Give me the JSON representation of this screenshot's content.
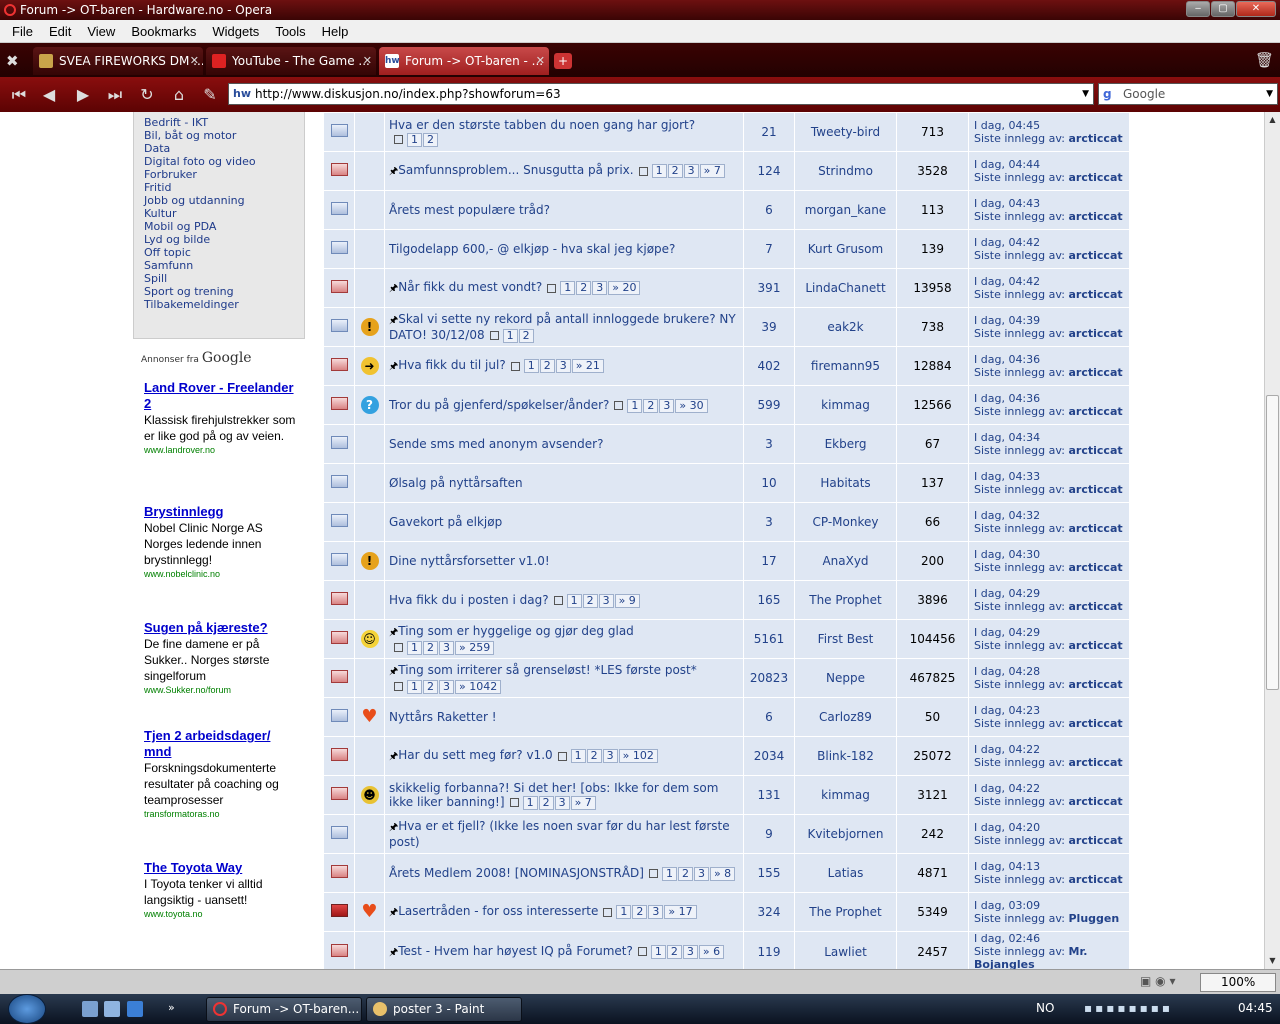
{
  "window": {
    "title": "Forum -> OT-baren - Hardware.no - Opera"
  },
  "menu": [
    "File",
    "Edit",
    "View",
    "Bookmarks",
    "Widgets",
    "Tools",
    "Help"
  ],
  "tabs": [
    {
      "label": "SVEA FIREWORKS DM ...",
      "active": false
    },
    {
      "label": "YouTube - The Game ...",
      "active": false
    },
    {
      "label": "Forum -> OT-baren - ...",
      "active": true
    }
  ],
  "address": {
    "url": "http://www.diskusjon.no/index.php?showforum=63",
    "search_placeholder": "Google"
  },
  "categories": [
    "Bedrift - IKT",
    "Bil, båt og motor",
    "Data",
    "Digital foto og video",
    "Forbruker",
    "Fritid",
    "Jobb og utdanning",
    "Kultur",
    "Mobil og PDA",
    "Lyd og bilde",
    "Off topic",
    "Samfunn",
    "Spill",
    "Sport og trening",
    "Tilbakemeldinger"
  ],
  "ads": {
    "header_prefix": "Annonser fra",
    "header_brand": "Google",
    "items": [
      {
        "title": "Land Rover - Freelander 2",
        "text": "Klassisk firehjulstrekker som er like god på og av veien.",
        "url": "www.landrover.no"
      },
      {
        "title": "Brystinnlegg",
        "text": "Nobel Clinic Norge AS Norges ledende innen brystinnlegg!",
        "url": "www.nobelclinic.no"
      },
      {
        "title": "Sugen på kjæreste?",
        "text": "De fine damene er på Sukker.. Norges største singelforum",
        "url": "www.Sukker.no/forum"
      },
      {
        "title": "Tjen 2 arbeidsdager/ mnd",
        "text": "Forskningsdokumenterte resultater på coaching og teamprosesser",
        "url": "transformatoras.no"
      },
      {
        "title": "The Toyota Way",
        "text": "I Toyota tenker vi alltid langsiktig - uansett!",
        "url": "www.toyota.no"
      }
    ]
  },
  "topics": [
    {
      "folder": "normal",
      "icon": "",
      "pinned": false,
      "title": "Hva er den største tabben du noen gang har gjort?",
      "pages": [
        "1",
        "2"
      ],
      "replies": "21",
      "author": "Tweety-bird",
      "views": "713",
      "time": "I dag, 04:45",
      "by_label": "Siste innlegg av:",
      "last_by": "arcticcat"
    },
    {
      "folder": "hot",
      "icon": "",
      "pinned": true,
      "title": "Samfunnsproblem... Snusgutta på prix.",
      "pages": [
        "1",
        "2",
        "3",
        "» 7"
      ],
      "replies": "124",
      "author": "Strindmo",
      "views": "3528",
      "time": "I dag, 04:44",
      "by_label": "Siste innlegg av:",
      "last_by": "arcticcat"
    },
    {
      "folder": "normal",
      "icon": "",
      "pinned": false,
      "title": "Årets mest populære tråd?",
      "pages": [],
      "replies": "6",
      "author": "morgan_kane",
      "views": "113",
      "time": "I dag, 04:43",
      "by_label": "Siste innlegg av:",
      "last_by": "arcticcat"
    },
    {
      "folder": "normal",
      "icon": "",
      "pinned": false,
      "title": "Tilgodelapp 600,- @ elkjøp - hva skal jeg kjøpe?",
      "pages": [],
      "replies": "7",
      "author": "Kurt Grusom",
      "views": "139",
      "time": "I dag, 04:42",
      "by_label": "Siste innlegg av:",
      "last_by": "arcticcat"
    },
    {
      "folder": "hot",
      "icon": "",
      "pinned": true,
      "title": "Når fikk du mest vondt?",
      "pages": [
        "1",
        "2",
        "3",
        "» 20"
      ],
      "replies": "391",
      "author": "LindaChanett",
      "views": "13958",
      "time": "I dag, 04:42",
      "by_label": "Siste innlegg av:",
      "last_by": "arcticcat"
    },
    {
      "folder": "normal",
      "icon": "warn",
      "pinned": true,
      "title": "Skal vi sette ny rekord på antall innloggede brukere? NY DATO! 30/12/08",
      "pages": [
        "1",
        "2"
      ],
      "replies": "39",
      "author": "eak2k",
      "views": "738",
      "time": "I dag, 04:39",
      "by_label": "Siste innlegg av:",
      "last_by": "arcticcat"
    },
    {
      "folder": "hot",
      "icon": "arrow",
      "pinned": true,
      "title": "Hva fikk du til jul?",
      "pages": [
        "1",
        "2",
        "3",
        "» 21"
      ],
      "replies": "402",
      "author": "firemann95",
      "views": "12884",
      "time": "I dag, 04:36",
      "by_label": "Siste innlegg av:",
      "last_by": "arcticcat"
    },
    {
      "folder": "hot",
      "icon": "question",
      "pinned": false,
      "title": "Tror du på gjenferd/spøkelser/ånder?",
      "pages": [
        "1",
        "2",
        "3",
        "» 30"
      ],
      "replies": "599",
      "author": "kimmag",
      "views": "12566",
      "time": "I dag, 04:36",
      "by_label": "Siste innlegg av:",
      "last_by": "arcticcat"
    },
    {
      "folder": "normal",
      "icon": "",
      "pinned": false,
      "title": "Sende sms med anonym avsender?",
      "pages": [],
      "replies": "3",
      "author": "Ekberg",
      "views": "67",
      "time": "I dag, 04:34",
      "by_label": "Siste innlegg av:",
      "last_by": "arcticcat"
    },
    {
      "folder": "normal",
      "icon": "",
      "pinned": false,
      "title": "Ølsalg på nyttårsaften",
      "pages": [],
      "replies": "10",
      "author": "Habitats",
      "views": "137",
      "time": "I dag, 04:33",
      "by_label": "Siste innlegg av:",
      "last_by": "arcticcat"
    },
    {
      "folder": "normal",
      "icon": "",
      "pinned": false,
      "title": "Gavekort på elkjøp",
      "pages": [],
      "replies": "3",
      "author": "CP-Monkey",
      "views": "66",
      "time": "I dag, 04:32",
      "by_label": "Siste innlegg av:",
      "last_by": "arcticcat"
    },
    {
      "folder": "normal",
      "icon": "warn",
      "pinned": false,
      "title": "Dine nyttårsforsetter v1.0!",
      "pages": [],
      "replies": "17",
      "author": "AnaXyd",
      "views": "200",
      "time": "I dag, 04:30",
      "by_label": "Siste innlegg av:",
      "last_by": "arcticcat"
    },
    {
      "folder": "hot",
      "icon": "",
      "pinned": false,
      "title": "Hva fikk du i posten i dag?",
      "pages": [
        "1",
        "2",
        "3",
        "» 9"
      ],
      "replies": "165",
      "author": "The Prophet",
      "views": "3896",
      "time": "I dag, 04:29",
      "by_label": "Siste innlegg av:",
      "last_by": "arcticcat"
    },
    {
      "folder": "hot",
      "icon": "smile",
      "pinned": true,
      "title": "Ting som er hyggelige og gjør deg glad",
      "pages": [
        "1",
        "2",
        "3",
        "» 259"
      ],
      "replies": "5161",
      "author": "First Best",
      "views": "104456",
      "time": "I dag, 04:29",
      "by_label": "Siste innlegg av:",
      "last_by": "arcticcat"
    },
    {
      "folder": "hot",
      "icon": "",
      "pinned": true,
      "title": "Ting som irriterer så grenseløst! *LES første post*",
      "pages": [
        "1",
        "2",
        "3",
        "» 1042"
      ],
      "replies": "20823",
      "author": "Neppe",
      "views": "467825",
      "time": "I dag, 04:28",
      "by_label": "Siste innlegg av:",
      "last_by": "arcticcat"
    },
    {
      "folder": "normal",
      "icon": "heart",
      "pinned": false,
      "title": "Nyttårs Raketter !",
      "pages": [],
      "replies": "6",
      "author": "Carloz89",
      "views": "50",
      "time": "I dag, 04:23",
      "by_label": "Siste innlegg av:",
      "last_by": "arcticcat"
    },
    {
      "folder": "hot",
      "icon": "",
      "pinned": true,
      "title": "Har du sett meg før? v1.0",
      "pages": [
        "1",
        "2",
        "3",
        "» 102"
      ],
      "replies": "2034",
      "author": "Blink-182",
      "views": "25072",
      "time": "I dag, 04:22",
      "by_label": "Siste innlegg av:",
      "last_by": "arcticcat"
    },
    {
      "folder": "hot",
      "icon": "cool",
      "pinned": false,
      "title": "skikkelig forbanna?! Si det her! [obs: Ikke for dem som ikke liker banning!]",
      "pages": [
        "1",
        "2",
        "3",
        "» 7"
      ],
      "replies": "131",
      "author": "kimmag",
      "views": "3121",
      "time": "I dag, 04:22",
      "by_label": "Siste innlegg av:",
      "last_by": "arcticcat"
    },
    {
      "folder": "normal",
      "icon": "",
      "pinned": true,
      "title": "Hva er et fjell? (Ikke les noen svar før du har lest første post)",
      "pages": [],
      "replies": "9",
      "author": "Kvitebjornen",
      "views": "242",
      "time": "I dag, 04:20",
      "by_label": "Siste innlegg av:",
      "last_by": "arcticcat"
    },
    {
      "folder": "hot",
      "icon": "",
      "pinned": false,
      "title": "Årets Medlem 2008! [NOMINASJONSTRÅD]",
      "pages": [
        "1",
        "2",
        "3",
        "» 8"
      ],
      "replies": "155",
      "author": "Latias",
      "views": "4871",
      "time": "I dag, 04:13",
      "by_label": "Siste innlegg av:",
      "last_by": "arcticcat"
    },
    {
      "folder": "locked",
      "icon": "heart",
      "pinned": true,
      "title": "Lasertråden - for oss interesserte",
      "pages": [
        "1",
        "2",
        "3",
        "» 17"
      ],
      "replies": "324",
      "author": "The Prophet",
      "views": "5349",
      "time": "I dag, 03:09",
      "by_label": "Siste innlegg av:",
      "last_by": "Pluggen"
    },
    {
      "folder": "hot",
      "icon": "",
      "pinned": true,
      "title": "Test - Hvem har høyest IQ på Forumet?",
      "pages": [
        "1",
        "2",
        "3",
        "» 6"
      ],
      "replies": "119",
      "author": "Lawliet",
      "views": "2457",
      "time": "I dag, 02:46",
      "by_label": "Siste innlegg av:",
      "last_by": "Mr. Bojangles"
    }
  ],
  "statusbar": {
    "zoom": "100%"
  },
  "taskbar": {
    "tasks": [
      "Forum -> OT-baren...",
      "poster 3 - Paint"
    ],
    "lang": "NO",
    "clock": "04:45"
  },
  "colors": {
    "title_bar": "#5a0909",
    "tab_active": "#b53232",
    "row_bg": "#dfe7f3",
    "link_blue": "#22428a",
    "ad_title": "#0000cc",
    "ad_url": "#008000"
  }
}
